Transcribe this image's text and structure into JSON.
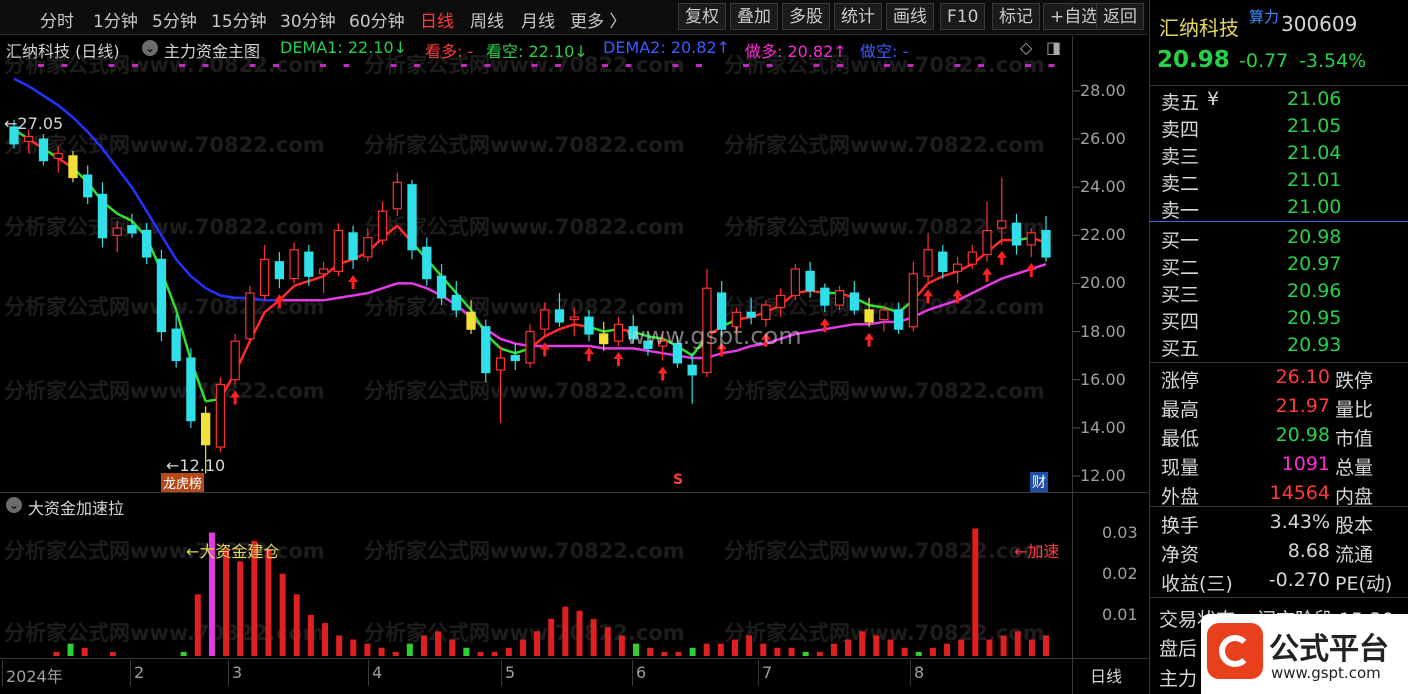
{
  "toolbar": {
    "periods": [
      "分时",
      "1分钟",
      "5分钟",
      "15分钟",
      "30分钟",
      "60分钟",
      "日线",
      "周线",
      "月线",
      "更多 〉"
    ],
    "active_period": "日线",
    "tools": [
      "复权",
      "叠加",
      "多股",
      "统计",
      "画线",
      "F10",
      "标记",
      "+自选",
      "返回"
    ]
  },
  "main_header": {
    "stock_label": "汇纳科技 (日线)",
    "indicator_name": "主力资金主图",
    "dema1": "DEMA1: 22.10↓",
    "kanduo": "看多: -",
    "kankong": "看空: 22.10↓",
    "dema2": "DEMA2: 20.82↑",
    "zuoduo": "做多: 20.82↑",
    "zuokong": "做空: -"
  },
  "price_axis": [
    "28.00",
    "26.00",
    "24.00",
    "22.00",
    "20.00",
    "18.00",
    "16.00",
    "14.00",
    "12.00"
  ],
  "annotations": {
    "high_label": "←27.05",
    "low_label": "←12.10",
    "badge_longhu": "龙虎榜",
    "badge_s": "S",
    "badge_cai": "财",
    "watermark_center": "www.gspt.com"
  },
  "sub_header": {
    "indicator_name": "大资金加速拉"
  },
  "sub_axis": [
    "0.03",
    "0.02",
    "0.01"
  ],
  "sub_annotations": {
    "build": "←大资金建仓",
    "accel": "←加速"
  },
  "time_axis": {
    "labels": [
      "2024年",
      "2",
      "3",
      "4",
      "5",
      "6",
      "7",
      "8"
    ],
    "period_tag": "日线"
  },
  "watermark": "分析家公式网www.70822.com",
  "quote": {
    "name": "汇纳科技",
    "suanli": "算力",
    "code": "300609",
    "price": "20.98",
    "change": "-0.77",
    "pct": "-3.54%",
    "asks": [
      {
        "label": "卖五",
        "mark": "¥",
        "price": "21.06"
      },
      {
        "label": "卖四",
        "mark": "",
        "price": "21.05"
      },
      {
        "label": "卖三",
        "mark": "",
        "price": "21.04"
      },
      {
        "label": "卖二",
        "mark": "",
        "price": "21.01"
      },
      {
        "label": "卖一",
        "mark": "",
        "price": "21.00"
      }
    ],
    "bids": [
      {
        "label": "买一",
        "price": "20.98"
      },
      {
        "label": "买二",
        "price": "20.97"
      },
      {
        "label": "买三",
        "price": "20.96"
      },
      {
        "label": "买四",
        "price": "20.95"
      },
      {
        "label": "买五",
        "price": "20.93"
      }
    ],
    "stats": [
      {
        "l": "涨停",
        "v": "26.10",
        "r": "跌停"
      },
      {
        "l": "最高",
        "v": "21.97",
        "r": "量比"
      },
      {
        "l": "最低",
        "v": "20.98",
        "r": "市值"
      },
      {
        "l": "现量",
        "v": "1091",
        "r": "总量"
      },
      {
        "l": "外盘",
        "v": "14564",
        "r": "内盘"
      }
    ],
    "stats2": [
      {
        "l": "换手",
        "v": "3.43%",
        "r": "股本"
      },
      {
        "l": "净资",
        "v": "8.68",
        "r": "流通"
      },
      {
        "l": "收益(三)",
        "v": "-0.270",
        "r": "PE(动)"
      }
    ],
    "status_label": "交易状态:",
    "status_value": "闭市阶段 15:30:",
    "pan_hou": "盘后",
    "zhu_li": "主力"
  },
  "logo": {
    "text": "公式平台",
    "url_text": "www.gspt.com",
    "colors": {
      "accent": "#e8401c"
    }
  },
  "chart_data": {
    "type": "candlestick",
    "ylim": [
      11.5,
      29.2
    ],
    "candles_ohlc": [
      [
        26.5,
        26.8,
        25.6,
        25.8
      ],
      [
        25.9,
        26.4,
        25.4,
        26.1
      ],
      [
        26.0,
        26.2,
        24.9,
        25.1
      ],
      [
        25.2,
        25.7,
        24.6,
        25.4
      ],
      [
        25.3,
        25.5,
        24.2,
        24.4
      ],
      [
        24.5,
        24.9,
        23.3,
        23.6
      ],
      [
        23.7,
        24.2,
        21.5,
        21.9
      ],
      [
        22.0,
        22.6,
        21.3,
        22.3
      ],
      [
        22.4,
        22.9,
        21.9,
        22.1
      ],
      [
        22.2,
        22.5,
        20.8,
        21.1
      ],
      [
        21.0,
        21.4,
        17.6,
        18.0
      ],
      [
        18.1,
        18.7,
        16.5,
        16.8
      ],
      [
        16.9,
        17.3,
        14.0,
        14.3
      ],
      [
        14.6,
        14.9,
        12.1,
        13.3
      ],
      [
        13.2,
        16.1,
        13.0,
        15.8
      ],
      [
        16.0,
        17.9,
        15.8,
        17.6
      ],
      [
        17.7,
        19.9,
        17.5,
        19.6
      ],
      [
        19.5,
        21.6,
        19.3,
        21.0
      ],
      [
        20.9,
        21.3,
        19.8,
        20.2
      ],
      [
        20.2,
        21.7,
        20.0,
        21.4
      ],
      [
        21.3,
        21.6,
        19.9,
        20.3
      ],
      [
        20.4,
        20.9,
        19.6,
        20.6
      ],
      [
        20.5,
        22.5,
        20.3,
        22.2
      ],
      [
        22.1,
        22.4,
        20.6,
        21.0
      ],
      [
        21.1,
        22.3,
        20.9,
        21.9
      ],
      [
        21.8,
        23.4,
        21.6,
        23.0
      ],
      [
        23.1,
        24.6,
        22.8,
        24.2
      ],
      [
        24.1,
        24.3,
        21.0,
        21.4
      ],
      [
        21.5,
        21.9,
        19.9,
        20.2
      ],
      [
        20.3,
        20.8,
        19.1,
        19.4
      ],
      [
        19.5,
        20.1,
        18.6,
        18.9
      ],
      [
        18.8,
        19.3,
        17.9,
        18.1
      ],
      [
        18.2,
        18.5,
        15.9,
        16.3
      ],
      [
        16.4,
        17.4,
        14.2,
        16.9
      ],
      [
        17.0,
        17.5,
        16.4,
        16.8
      ],
      [
        16.7,
        18.3,
        16.5,
        18.0
      ],
      [
        18.1,
        19.2,
        17.8,
        18.9
      ],
      [
        18.9,
        19.6,
        18.2,
        18.4
      ],
      [
        18.5,
        19.0,
        17.8,
        18.6
      ],
      [
        18.6,
        18.9,
        17.6,
        17.9
      ],
      [
        17.9,
        18.4,
        17.2,
        17.5
      ],
      [
        17.6,
        18.6,
        17.4,
        18.3
      ],
      [
        18.2,
        18.7,
        17.5,
        17.7
      ],
      [
        17.6,
        18.0,
        17.0,
        17.3
      ],
      [
        17.4,
        17.9,
        16.8,
        17.6
      ],
      [
        17.5,
        17.8,
        16.5,
        16.7
      ],
      [
        16.6,
        17.1,
        15.0,
        16.2
      ],
      [
        16.3,
        20.6,
        16.1,
        19.8
      ],
      [
        19.6,
        20.1,
        17.8,
        18.1
      ],
      [
        18.2,
        19.0,
        17.9,
        18.8
      ],
      [
        18.8,
        19.4,
        18.3,
        18.6
      ],
      [
        18.5,
        19.3,
        18.2,
        19.1
      ],
      [
        19.0,
        19.8,
        18.6,
        19.5
      ],
      [
        19.5,
        20.8,
        19.3,
        20.6
      ],
      [
        20.5,
        20.9,
        19.4,
        19.7
      ],
      [
        19.8,
        20.0,
        18.8,
        19.1
      ],
      [
        19.1,
        19.9,
        18.9,
        19.7
      ],
      [
        19.6,
        20.1,
        18.7,
        18.9
      ],
      [
        18.9,
        19.4,
        18.2,
        18.4
      ],
      [
        18.5,
        19.1,
        18.0,
        18.9
      ],
      [
        18.9,
        19.2,
        17.9,
        18.1
      ],
      [
        18.2,
        20.9,
        18.0,
        20.4
      ],
      [
        20.3,
        22.1,
        20.0,
        21.4
      ],
      [
        21.3,
        21.6,
        20.2,
        20.5
      ],
      [
        20.5,
        21.1,
        20.0,
        20.8
      ],
      [
        20.8,
        21.6,
        20.6,
        21.3
      ],
      [
        21.2,
        23.4,
        20.9,
        22.2
      ],
      [
        22.3,
        24.4,
        21.6,
        22.6
      ],
      [
        22.5,
        22.9,
        21.2,
        21.6
      ],
      [
        21.6,
        22.3,
        21.1,
        22.1
      ],
      [
        22.2,
        22.8,
        20.9,
        21.1
      ]
    ],
    "dema1_line": [
      26.4,
      26.0,
      25.6,
      25.2,
      24.8,
      24.2,
      23.4,
      22.9,
      22.6,
      21.9,
      20.5,
      18.9,
      16.8,
      15.1,
      15.2,
      16.3,
      17.6,
      18.8,
      19.3,
      19.9,
      20.1,
      20.3,
      20.8,
      21.0,
      21.3,
      21.9,
      22.4,
      21.7,
      21.0,
      20.3,
      19.6,
      18.9,
      17.9,
      17.3,
      17.1,
      17.3,
      17.8,
      18.1,
      18.3,
      18.2,
      18.0,
      18.1,
      18.0,
      17.8,
      17.7,
      17.4,
      17.0,
      17.8,
      18.2,
      18.5,
      18.6,
      18.8,
      19.1,
      19.6,
      19.7,
      19.6,
      19.6,
      19.4,
      19.1,
      19.0,
      18.8,
      19.3,
      20.0,
      20.3,
      20.5,
      20.8,
      21.3,
      21.8,
      21.8,
      21.9,
      21.7
    ],
    "dema2_line": [
      28.5,
      28.2,
      27.8,
      27.4,
      26.9,
      26.3,
      25.6,
      24.8,
      24.0,
      23.0,
      22.0,
      21.0,
      20.3,
      19.8,
      19.5,
      19.4,
      19.4,
      19.3,
      19.3,
      19.3,
      19.3,
      19.3,
      19.4,
      19.5,
      19.6,
      19.8,
      20.0,
      20.0,
      19.8,
      19.5,
      19.1,
      18.6,
      18.1,
      17.7,
      17.5,
      17.4,
      17.4,
      17.4,
      17.4,
      17.4,
      17.3,
      17.3,
      17.3,
      17.2,
      17.1,
      17.0,
      16.9,
      16.9,
      17.1,
      17.2,
      17.4,
      17.5,
      17.7,
      17.9,
      18.0,
      18.1,
      18.2,
      18.3,
      18.3,
      18.4,
      18.4,
      18.6,
      18.9,
      19.1,
      19.3,
      19.6,
      19.9,
      20.2,
      20.4,
      20.6,
      20.8
    ],
    "dema_split_index": 18,
    "up_arrow_indices": [
      15,
      18,
      23,
      36,
      39,
      41,
      44,
      48,
      51,
      55,
      58,
      62,
      64,
      66,
      67,
      69
    ],
    "sub_values": [
      0,
      0,
      0,
      0.001,
      0.003,
      0.002,
      0,
      0.001,
      0,
      0,
      0,
      0,
      0.001,
      0.015,
      0.03,
      0.026,
      0.023,
      0.028,
      0.026,
      0.02,
      0.015,
      0.01,
      0.008,
      0.005,
      0.004,
      0.003,
      0.002,
      0.001,
      0.003,
      0.005,
      0.006,
      0.004,
      0.002,
      0.001,
      0.001,
      0.002,
      0.004,
      0.006,
      0.009,
      0.012,
      0.011,
      0.009,
      0.007,
      0.005,
      0.003,
      0.002,
      0.001,
      0.001,
      0.002,
      0.003,
      0.003,
      0.004,
      0.005,
      0.003,
      0.002,
      0.002,
      0.001,
      0.001,
      0.003,
      0.004,
      0.006,
      0.005,
      0.004,
      0.002,
      0.001,
      0.002,
      0.003,
      0.004,
      0.031,
      0.004,
      0.005,
      0.006,
      0.004,
      0.005
    ],
    "sub_magenta_index": 14,
    "sub_ylim": [
      0,
      0.035
    ]
  }
}
